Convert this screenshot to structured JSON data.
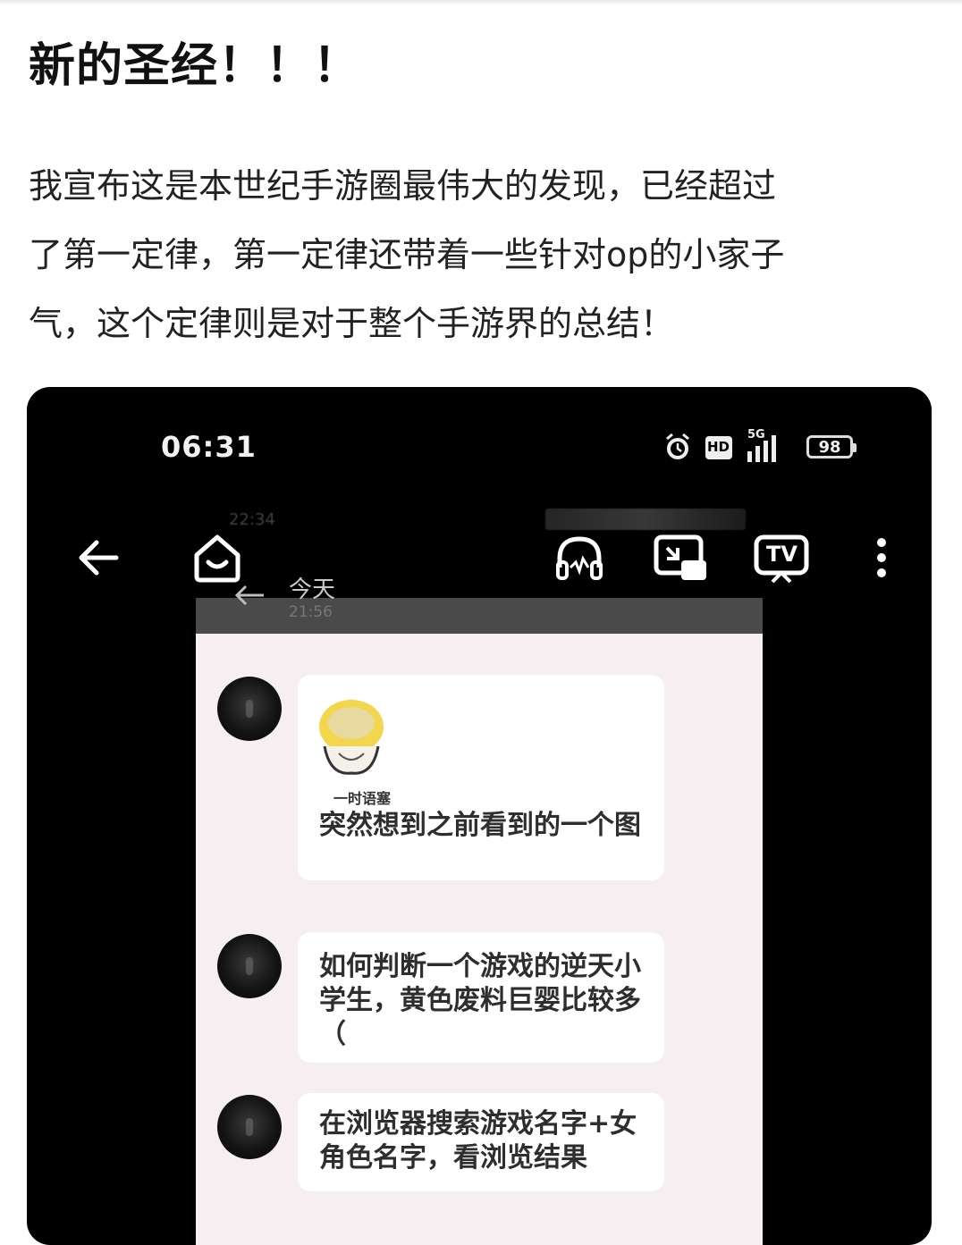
{
  "post": {
    "title": "新的圣经！！！",
    "body_lines": [
      "我宣布这是本世纪手游圈最伟大的发现，已经超过",
      "了第一定律，第一定律还带着一些针对op的小家子",
      "气，这个定律则是对于整个手游界的总结！"
    ]
  },
  "screenshot": {
    "status_bar": {
      "time": "06:31",
      "network": "5G",
      "hd_label": "HD",
      "battery": "98",
      "icons": [
        "alarm-icon",
        "hd-icon",
        "signal-icon",
        "battery-icon"
      ]
    },
    "toolbar": {
      "icons": [
        "back-arrow-icon",
        "home-icon",
        "headphones-icon",
        "pip-icon",
        "tv-icon",
        "more-icon"
      ],
      "tv_label": "TV"
    },
    "chat": {
      "header_today": "今天",
      "header_time": "21:56",
      "ghost_time": "22:34",
      "sticker_caption": "一时语塞",
      "messages": [
        {
          "text": "突然想到之前看到的一个图"
        },
        {
          "text": "如何判断一个游戏的逆天小学生，黄色废料巨婴比较多（"
        },
        {
          "text": "在浏览器搜索游戏名字+女角色名字，看浏览结果"
        }
      ]
    },
    "colors": {
      "background": "#000000",
      "chat_bg": "#f7eef1",
      "bubble": "#ffffff"
    }
  }
}
